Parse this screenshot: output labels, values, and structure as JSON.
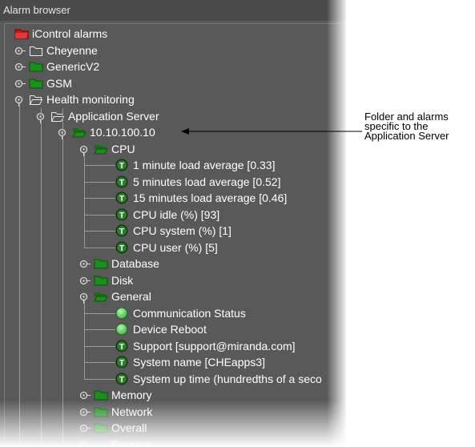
{
  "window": {
    "title": "Alarm browser"
  },
  "tree": [
    {
      "label": "iControl alarms",
      "depth": 0,
      "expander": "none",
      "icon": "red-folder-icon"
    },
    {
      "label": "Cheyenne",
      "depth": 0,
      "expander": "closed",
      "icon": "empty-folder-icon"
    },
    {
      "label": "GenericV2",
      "depth": 0,
      "expander": "closed",
      "icon": "green-folder-icon"
    },
    {
      "label": "GSM",
      "depth": 0,
      "expander": "closed",
      "icon": "green-folder-icon"
    },
    {
      "label": "Health monitoring",
      "depth": 0,
      "expander": "open",
      "icon": "open-empty-folder-icon"
    },
    {
      "label": "Application Server",
      "depth": 1,
      "expander": "open",
      "icon": "open-empty-folder-icon"
    },
    {
      "label": "10.10.100.10",
      "depth": 2,
      "expander": "open",
      "icon": "open-green-folder-icon"
    },
    {
      "label": "CPU",
      "depth": 3,
      "expander": "open",
      "icon": "open-green-folder-icon"
    },
    {
      "label": "1 minute load average [0.33]",
      "depth": 4,
      "expander": "none",
      "icon": "t-alarm-icon"
    },
    {
      "label": "5 minutes load average [0.52]",
      "depth": 4,
      "expander": "none",
      "icon": "t-alarm-icon"
    },
    {
      "label": "15 minutes load average [0.46]",
      "depth": 4,
      "expander": "none",
      "icon": "t-alarm-icon"
    },
    {
      "label": "CPU idle (%) [93]",
      "depth": 4,
      "expander": "none",
      "icon": "t-alarm-icon"
    },
    {
      "label": "CPU system (%) [1]",
      "depth": 4,
      "expander": "none",
      "icon": "t-alarm-icon"
    },
    {
      "label": "CPU user (%) [5]",
      "depth": 4,
      "expander": "none",
      "icon": "t-alarm-icon"
    },
    {
      "label": "Database",
      "depth": 3,
      "expander": "closed",
      "icon": "green-folder-icon"
    },
    {
      "label": "Disk",
      "depth": 3,
      "expander": "closed",
      "icon": "green-folder-icon"
    },
    {
      "label": "General",
      "depth": 3,
      "expander": "open",
      "icon": "open-green-folder-icon"
    },
    {
      "label": "Communication Status",
      "depth": 4,
      "expander": "none",
      "icon": "green-led-icon"
    },
    {
      "label": "Device Reboot",
      "depth": 4,
      "expander": "none",
      "icon": "green-led-icon"
    },
    {
      "label": "Support [support@miranda.com]",
      "depth": 4,
      "expander": "none",
      "icon": "t-alarm-icon"
    },
    {
      "label": "System name [CHEapps3]",
      "depth": 4,
      "expander": "none",
      "icon": "t-alarm-icon"
    },
    {
      "label": "System up time (hundredths of a seco",
      "depth": 4,
      "expander": "none",
      "icon": "t-alarm-icon"
    },
    {
      "label": "Memory",
      "depth": 3,
      "expander": "closed",
      "icon": "green-folder-icon"
    },
    {
      "label": "Network",
      "depth": 3,
      "expander": "closed",
      "icon": "green-folder-icon"
    },
    {
      "label": "Overall",
      "depth": 3,
      "expander": "closed",
      "icon": "green-folder-icon"
    },
    {
      "label": "Process",
      "depth": 3,
      "expander": "closed",
      "icon": "green-folder-icon"
    }
  ],
  "callout": {
    "lines": [
      "Folder and alarms",
      "specific to the",
      "Application Server"
    ]
  },
  "colors": {
    "panel_bg": "#595959",
    "label": "#ffffff",
    "folder_green": "#1b8f1b",
    "folder_red": "#c81818",
    "led_green": "#3fb93f",
    "alarm_dark": "#1e5e1e"
  }
}
